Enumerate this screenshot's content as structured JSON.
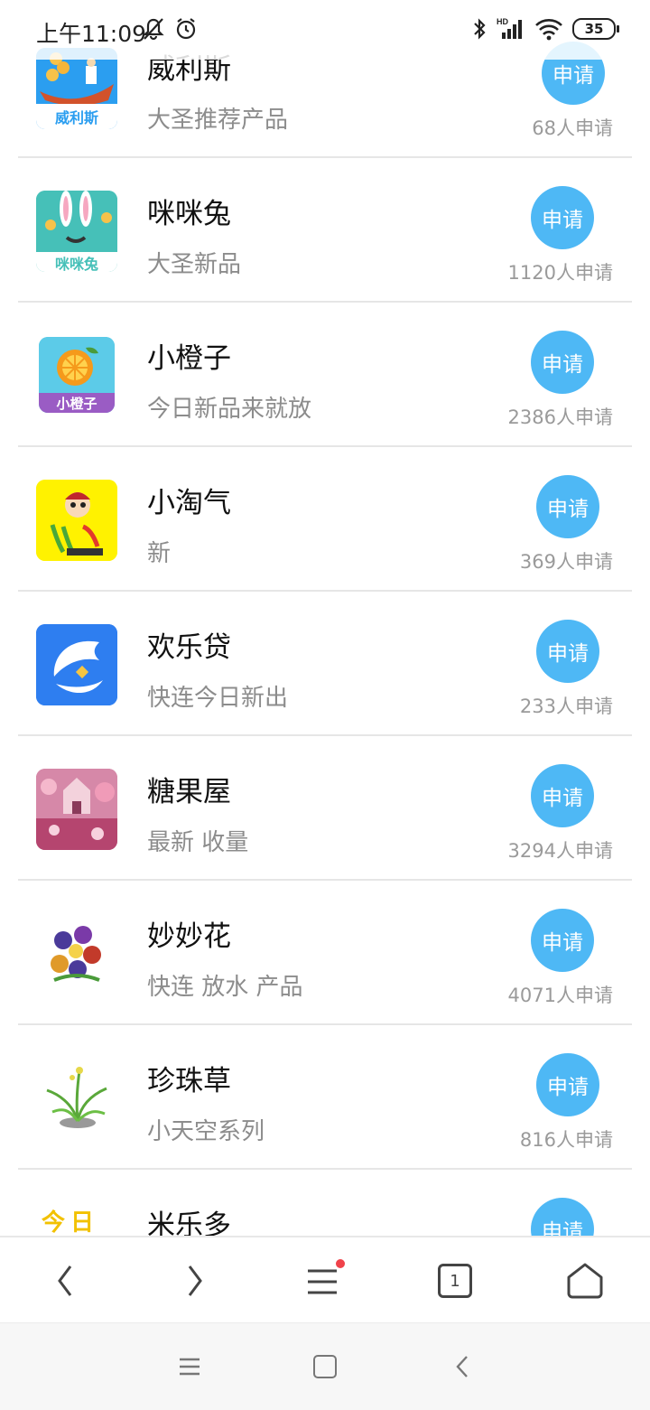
{
  "status_bar": {
    "time": "上午11:09",
    "battery": "35"
  },
  "list": {
    "items": [
      {
        "name": "威利斯",
        "desc": "大圣推荐产品",
        "button": "申请",
        "count": "68人申请",
        "logo_text": "威利斯"
      },
      {
        "name": "咪咪兔",
        "desc": "大圣新品",
        "button": "申请",
        "count": "1120人申请",
        "logo_text": "咪咪兔"
      },
      {
        "name": "小橙子",
        "desc": "今日新品来就放",
        "button": "申请",
        "count": "2386人申请",
        "logo_text": "小橙子"
      },
      {
        "name": "小淘气",
        "desc": "新",
        "button": "申请",
        "count": "369人申请"
      },
      {
        "name": "欢乐贷",
        "desc": "快连今日新出",
        "button": "申请",
        "count": "233人申请"
      },
      {
        "name": "糖果屋",
        "desc": "最新 收量",
        "button": "申请",
        "count": "3294人申请"
      },
      {
        "name": "妙妙花",
        "desc": "快连 放水 产品",
        "button": "申请",
        "count": "4071人申请"
      },
      {
        "name": "珍珠草",
        "desc": "小天空系列",
        "button": "申请",
        "count": "816人申请"
      },
      {
        "name": "米乐多",
        "desc": "",
        "button": "申请",
        "count": "",
        "logo_text": "今日"
      }
    ]
  },
  "bottom_nav": {
    "tab_count": "1"
  },
  "colors": {
    "accent": "#4eb8f5",
    "badge": "#f0424a"
  }
}
